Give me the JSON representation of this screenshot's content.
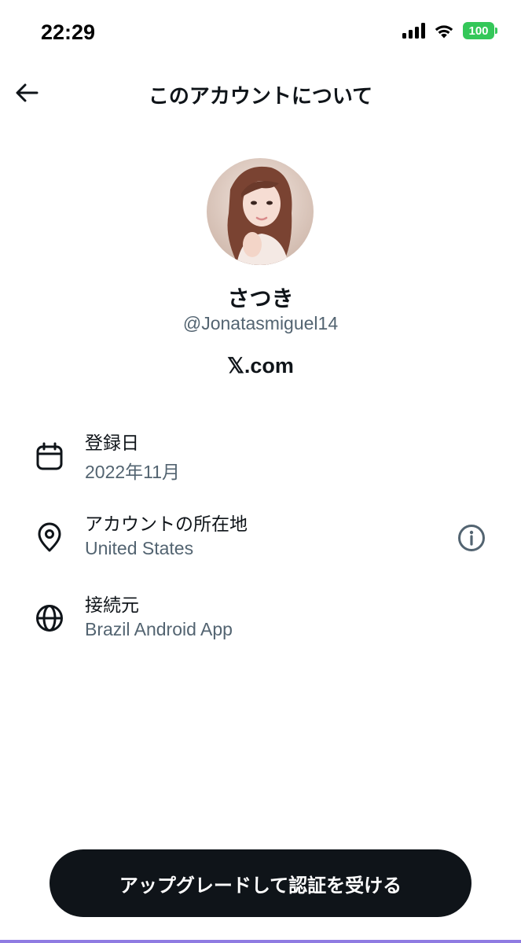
{
  "status_bar": {
    "time": "22:29",
    "battery": "100",
    "icons": [
      "signal-icon",
      "wifi-icon",
      "battery-icon"
    ]
  },
  "header": {
    "title": "このアカウントについて",
    "back_icon": "arrow-left-icon"
  },
  "profile": {
    "display_name": "さつき",
    "handle": "@Jonatasmiguel14",
    "site": "𝕏.com"
  },
  "info": {
    "registered": {
      "label": "登録日",
      "value": "2022年11月",
      "icon": "calendar-icon"
    },
    "location": {
      "label": "アカウントの所在地",
      "value": "United States",
      "icon": "location-pin-icon",
      "action_icon": "info-icon"
    },
    "connection": {
      "label": "接続元",
      "value": "Brazil Android App",
      "icon": "globe-icon"
    }
  },
  "cta": {
    "label": "アップグレードして認証を受ける"
  },
  "colors": {
    "primary_text": "#0f1419",
    "secondary_text": "#536471",
    "button_bg": "#0f1419",
    "battery": "#34c759",
    "accent_line": "#8f7be2"
  }
}
